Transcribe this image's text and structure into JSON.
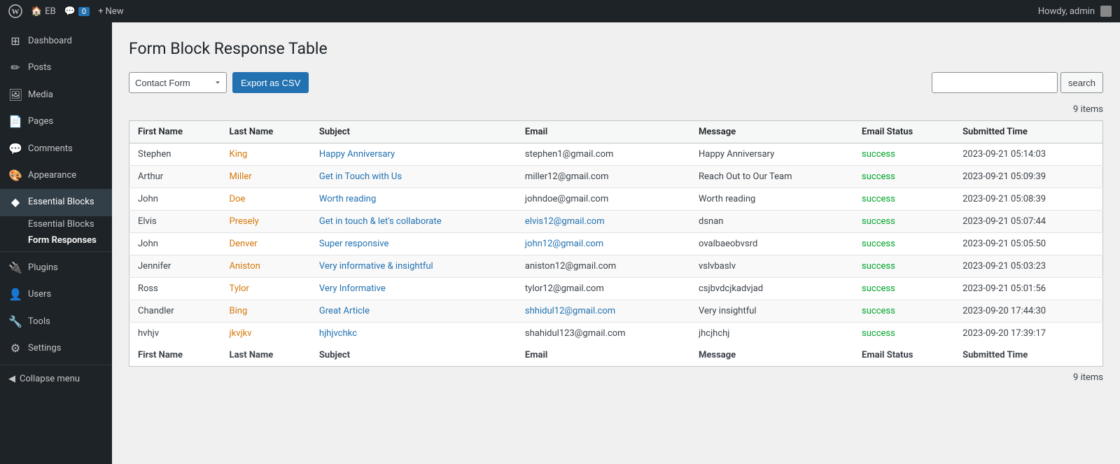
{
  "adminBar": {
    "wpLogo": "W",
    "siteShort": "EB",
    "commentCount": "0",
    "newLabel": "+ New",
    "howdy": "Howdy, admin"
  },
  "sidebar": {
    "items": [
      {
        "id": "dashboard",
        "label": "Dashboard",
        "icon": "⊞"
      },
      {
        "id": "posts",
        "label": "Posts",
        "icon": "📝"
      },
      {
        "id": "media",
        "label": "Media",
        "icon": "🖼"
      },
      {
        "id": "pages",
        "label": "Pages",
        "icon": "📄"
      },
      {
        "id": "comments",
        "label": "Comments",
        "icon": "💬"
      },
      {
        "id": "appearance",
        "label": "Appearance",
        "icon": "🎨"
      },
      {
        "id": "essential-blocks",
        "label": "Essential Blocks",
        "icon": "🔷"
      }
    ],
    "subItems": [
      {
        "id": "essential-blocks-sub",
        "label": "Essential Blocks"
      },
      {
        "id": "form-responses",
        "label": "Form Responses"
      }
    ],
    "bottomItems": [
      {
        "id": "plugins",
        "label": "Plugins",
        "icon": "🔌"
      },
      {
        "id": "users",
        "label": "Users",
        "icon": "👤"
      },
      {
        "id": "tools",
        "label": "Tools",
        "icon": "🔧"
      },
      {
        "id": "settings",
        "label": "Settings",
        "icon": "⚙"
      }
    ],
    "collapseLabel": "Collapse menu"
  },
  "page": {
    "title": "Form Block Response Table"
  },
  "toolbar": {
    "formSelectValue": "Contact Form",
    "formSelectOptions": [
      "Contact Form"
    ],
    "exportBtnLabel": "Export as CSV",
    "searchPlaceholder": "",
    "searchBtnLabel": "search"
  },
  "table": {
    "itemsCount": "9 items",
    "footerCount": "9 items",
    "headers": [
      "First Name",
      "Last Name",
      "Subject",
      "Email",
      "Message",
      "Email Status",
      "Submitted Time"
    ],
    "rows": [
      {
        "firstName": "Stephen",
        "firstNameColor": "dark",
        "lastName": "King",
        "lastNameColor": "orange",
        "subject": "Happy Anniversary",
        "subjectColor": "blue",
        "email": "stephen1@gmail.com",
        "emailColor": "dark",
        "message": "Happy Anniversary",
        "messageColor": "dark",
        "status": "success",
        "statusColor": "green",
        "submitted": "2023-09-21 05:14:03",
        "alt": false
      },
      {
        "firstName": "Arthur",
        "firstNameColor": "dark",
        "lastName": "Miller",
        "lastNameColor": "orange",
        "subject": "Get in Touch with Us",
        "subjectColor": "blue",
        "email": "miller12@gmail.com",
        "emailColor": "dark",
        "message": "Reach Out to Our Team",
        "messageColor": "dark",
        "status": "success",
        "statusColor": "green",
        "submitted": "2023-09-21 05:09:39",
        "alt": true
      },
      {
        "firstName": "John",
        "firstNameColor": "dark",
        "lastName": "Doe",
        "lastNameColor": "orange",
        "subject": "Worth reading",
        "subjectColor": "blue",
        "email": "johndoe@gmail.com",
        "emailColor": "dark",
        "message": "Worth reading",
        "messageColor": "dark",
        "status": "success",
        "statusColor": "green",
        "submitted": "2023-09-21 05:08:39",
        "alt": false
      },
      {
        "firstName": "Elvis",
        "firstNameColor": "dark",
        "lastName": "Presely",
        "lastNameColor": "orange",
        "subject": "Get in touch & let's collaborate",
        "subjectColor": "blue",
        "email": "elvis12@gmail.com",
        "emailColor": "blue",
        "message": "dsnan",
        "messageColor": "dark",
        "status": "success",
        "statusColor": "green",
        "submitted": "2023-09-21 05:07:44",
        "alt": true
      },
      {
        "firstName": "John",
        "firstNameColor": "dark",
        "lastName": "Denver",
        "lastNameColor": "orange",
        "subject": "Super responsive",
        "subjectColor": "blue",
        "email": "john12@gmail.com",
        "emailColor": "blue",
        "message": "ovalbaeobvsrd",
        "messageColor": "dark",
        "status": "success",
        "statusColor": "green",
        "submitted": "2023-09-21 05:05:50",
        "alt": false
      },
      {
        "firstName": "Jennifer",
        "firstNameColor": "dark",
        "lastName": "Aniston",
        "lastNameColor": "orange",
        "subject": "Very informative & insightful",
        "subjectColor": "blue",
        "email": "aniston12@gmail.com",
        "emailColor": "dark",
        "message": "vslvbaslv",
        "messageColor": "dark",
        "status": "success",
        "statusColor": "green",
        "submitted": "2023-09-21 05:03:23",
        "alt": true
      },
      {
        "firstName": "Ross",
        "firstNameColor": "dark",
        "lastName": "Tylor",
        "lastNameColor": "orange",
        "subject": "Very Informative",
        "subjectColor": "blue",
        "email": "tylor12@gmail.com",
        "emailColor": "dark",
        "message": "csjbvdcjkadvjad",
        "messageColor": "dark",
        "status": "success",
        "statusColor": "green",
        "submitted": "2023-09-21 05:01:56",
        "alt": false
      },
      {
        "firstName": "Chandler",
        "firstNameColor": "dark",
        "lastName": "Bing",
        "lastNameColor": "orange",
        "subject": "Great Article",
        "subjectColor": "blue",
        "email": "shhidul12@gmail.com",
        "emailColor": "blue",
        "message": "Very insightful",
        "messageColor": "dark",
        "status": "success",
        "statusColor": "green",
        "submitted": "2023-09-20 17:44:30",
        "alt": true
      },
      {
        "firstName": "hvhjv",
        "firstNameColor": "dark",
        "lastName": "jkvjkv",
        "lastNameColor": "orange",
        "subject": "hjhjvchkc",
        "subjectColor": "blue",
        "email": "shahidul123@gmail.com",
        "emailColor": "dark",
        "message": "jhcjhchj",
        "messageColor": "dark",
        "status": "success",
        "statusColor": "green",
        "submitted": "2023-09-20 17:39:17",
        "alt": false
      }
    ],
    "footerHeaders": [
      "First Name",
      "Last Name",
      "Subject",
      "Email",
      "Message",
      "Email Status",
      "Submitted Time"
    ]
  }
}
